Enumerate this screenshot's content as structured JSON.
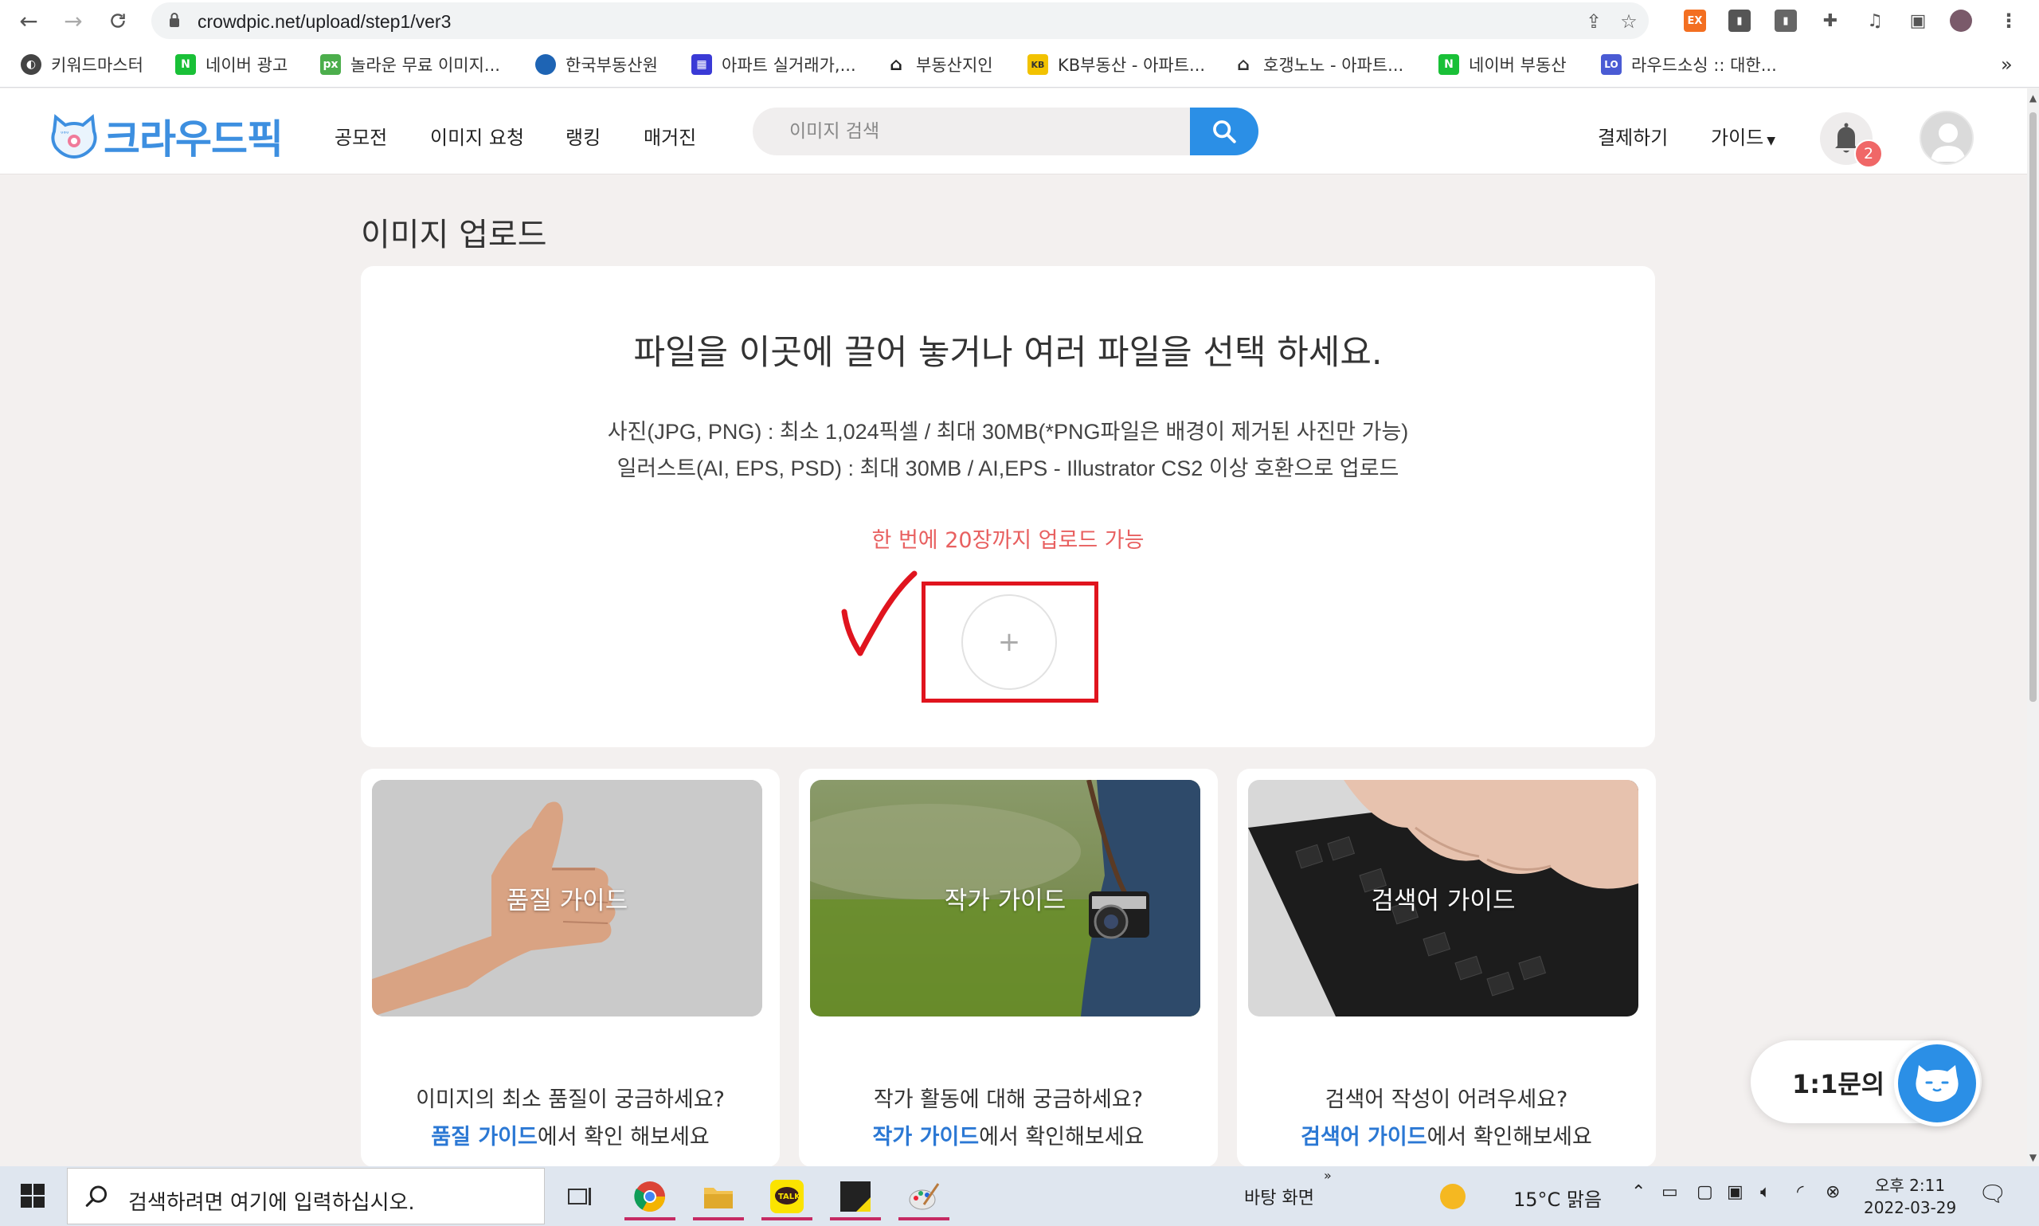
{
  "browser": {
    "url": "crowdpic.net/upload/step1/ver3",
    "extension_ex": "EX",
    "bookmarks": [
      {
        "label": "키워드마스터",
        "color": "#444444",
        "glyph": ""
      },
      {
        "label": "네이버 광고",
        "color": "#19c037",
        "glyph": "N"
      },
      {
        "label": "놀라운 무료 이미지...",
        "color": "#4cae4c",
        "glyph": "px"
      },
      {
        "label": "한국부동산원",
        "color": "#1e64b4",
        "glyph": ""
      },
      {
        "label": "아파트 실거래가,...",
        "color": "#3a3ad6",
        "glyph": ""
      },
      {
        "label": "부동산지인",
        "color": "#222222",
        "glyph": ""
      },
      {
        "label": "KB부동산 - 아파트...",
        "color": "#f2c200",
        "glyph": ""
      },
      {
        "label": "호갱노노 - 아파트...",
        "color": "#333333",
        "glyph": ""
      },
      {
        "label": "네이버 부동산",
        "color": "#19c037",
        "glyph": "N"
      },
      {
        "label": "라우드소싱 :: 대한...",
        "color": "#4a5bd4",
        "glyph": "LO"
      }
    ],
    "more_bookmarks": "»"
  },
  "header": {
    "logo_text": "크라우드픽",
    "nav": [
      "공모전",
      "이미지 요청",
      "랭킹",
      "매거진"
    ],
    "search_placeholder": "이미지 검색",
    "pay_label": "결제하기",
    "guide_label": "가이드",
    "notification_count": "2"
  },
  "main": {
    "page_title": "이미지 업로드",
    "headline": "파일을 이곳에 끌어 놓거나 여러 파일을 선택 하세요.",
    "desc_photo": "사진(JPG, PNG) : 최소 1,024픽셀 / 최대 30MB(*PNG파일은 배경이 제거된 사진만 가능)",
    "desc_illust": "일러스트(AI, EPS, PSD) : 최대 30MB / AI,EPS - Illustrator CS2 이상 호환으로 업로드",
    "limit_notice": "한 번에 20장까지 업로드 가능",
    "add_symbol": "+"
  },
  "guides": [
    {
      "image_label": "품질 가이드",
      "question": "이미지의 최소 품질이 궁금하세요?",
      "link": "품질 가이드",
      "suffix": "에서 확인 해보세요"
    },
    {
      "image_label": "작가 가이드",
      "question": "작가 활동에 대해 궁금하세요?",
      "link": "작가 가이드",
      "suffix": "에서 확인해보세요"
    },
    {
      "image_label": "검색어 가이드",
      "question": "검색어 작성이 어려우세요?",
      "link": "검색어 가이드",
      "suffix": "에서 확인해보세요"
    }
  ],
  "inquiry": {
    "label": "1:1문의"
  },
  "taskbar": {
    "search_placeholder": "검색하려면 여기에 입력하십시오.",
    "desktop_label": "바탕 화면",
    "chevron": "»",
    "weather": "15°C  맑음",
    "time": "오후 2:11",
    "date": "2022-03-29"
  },
  "colors": {
    "brand_blue": "#2b8fe6",
    "notice_red": "#e86060",
    "annotation_red": "#e0141e",
    "link_blue": "#2b78d4"
  }
}
